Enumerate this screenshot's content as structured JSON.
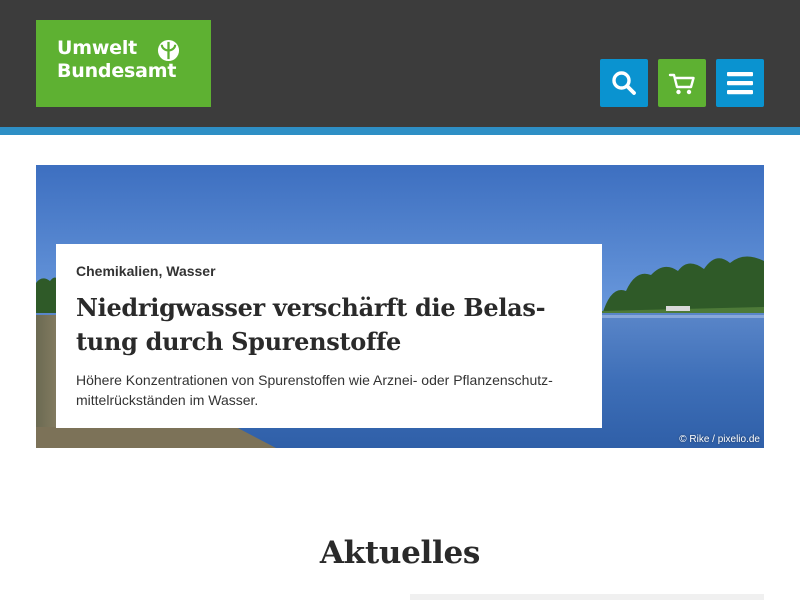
{
  "header": {
    "logo": {
      "line1": "Umwelt",
      "line2": "Bundesamt"
    },
    "buttons": {
      "search_icon": "search-icon",
      "cart_icon": "cart-icon",
      "menu_icon": "menu-icon"
    },
    "colors": {
      "background": "#3c3c3c",
      "stripe": "#2e8fc5",
      "green": "#5eb132",
      "blue": "#0a93d0"
    }
  },
  "hero": {
    "tags": "Chemikalien, Wasser",
    "title": "Niedrigwasser verschärft die Belas­tung durch Spurenstoffe",
    "teaser": "Höhere Konzentrationen von Spurenstoffen wie Arznei- oder Pflanzenschutz­mittelrückständen im Wasser.",
    "credit": "© Rike / pixelio.de"
  },
  "section": {
    "title": "Aktuelles"
  }
}
